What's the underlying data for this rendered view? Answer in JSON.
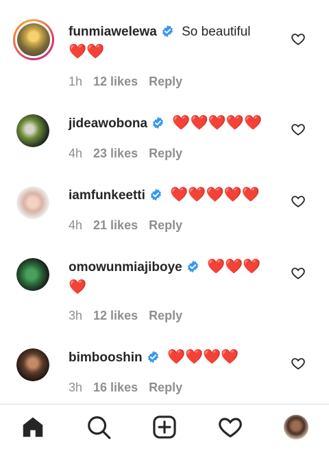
{
  "comments": [
    {
      "username": "funmiawelewa",
      "verified": true,
      "text": "So beautiful",
      "text_line2": "❤️❤️",
      "time": "1h",
      "likes": "12 likes",
      "reply": "Reply",
      "has_story": true
    },
    {
      "username": "jideawobona",
      "verified": true,
      "text": "❤️❤️❤️❤️❤️",
      "time": "4h",
      "likes": "23 likes",
      "reply": "Reply",
      "has_story": false
    },
    {
      "username": "iamfunkeetti",
      "verified": true,
      "text": "❤️❤️❤️❤️❤️",
      "time": "4h",
      "likes": "21 likes",
      "reply": "Reply",
      "has_story": false
    },
    {
      "username": "omowunmiajiboye",
      "verified": true,
      "text": "❤️❤️❤️",
      "text_line2": "❤️",
      "time": "3h",
      "likes": "12 likes",
      "reply": "Reply",
      "has_story": false
    },
    {
      "username": "bimbooshin",
      "verified": true,
      "text": "❤️❤️❤️❤️",
      "time": "3h",
      "likes": "16 likes",
      "reply": "Reply",
      "has_story": false
    }
  ],
  "nav": {
    "items": [
      "home-icon",
      "search-icon",
      "new-post-icon",
      "activity-heart-icon",
      "profile-avatar"
    ]
  },
  "colors": {
    "verified": "#3897f0",
    "heart": "#e0245e",
    "meta": "#8e8e8e",
    "text": "#262626"
  }
}
